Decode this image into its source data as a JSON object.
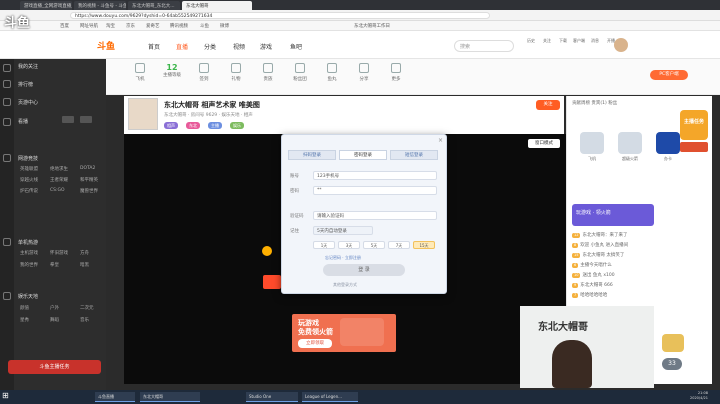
{
  "browser": {
    "tabs": [
      "游戏直播_全网游戏直播_斗鱼直播",
      "我的视频 - 斗鱼号 - 斗鱼",
      "东北大帽哥_东北大...",
      "东北大帽哥"
    ],
    "url": "https://www.douyu.com/9629?dyshid=0-64ab552549271634",
    "bookmarks": [
      "百度",
      "网址导航",
      "淘宝",
      "京东",
      "爱奇艺",
      "腾讯视频",
      "斗鱼",
      "微博",
      "东北大帽哥工作日"
    ]
  },
  "site": {
    "logo_text": "斗鱼",
    "nav": [
      "首页",
      "直播",
      "分类",
      "视频",
      "游戏",
      "鱼吧"
    ],
    "active_nav": "直播",
    "search_placeholder": "搜索",
    "header_icons": [
      "历史",
      "关注",
      "下载",
      "客户端",
      "消息",
      "开播"
    ]
  },
  "watermark": "斗鱼",
  "sidebar": {
    "sections": [
      {
        "title": "我的关注",
        "items": []
      },
      {
        "title": "排行榜",
        "items": []
      },
      {
        "title": "页游中心",
        "items": []
      },
      {
        "title": "看播",
        "items": []
      },
      {
        "title": "网游竞技",
        "items": [
          "英雄联盟",
          "绝地求生",
          "DOTA2",
          "穿越火线",
          "王者荣耀",
          "和平精英",
          "炉石传说",
          "CS:GO",
          "魔兽世界"
        ]
      },
      {
        "title": "单机热游",
        "items": [
          "主机游戏",
          "怀旧游戏",
          "方舟",
          "我的世界",
          "拳皇",
          "暗黑"
        ]
      },
      {
        "title": "娱乐天地",
        "items": [
          "颜值",
          "户外",
          "二次元",
          "星秀",
          "舞蹈",
          "音乐"
        ]
      }
    ],
    "promo": "斗鱼主播任务"
  },
  "category_bar": [
    {
      "icon": "plane-icon",
      "label": "飞机"
    },
    {
      "icon": "level-icon",
      "label": "主播等级",
      "value": "12"
    },
    {
      "icon": "edit-icon",
      "label": "签到"
    },
    {
      "icon": "gift-box-icon",
      "label": "礼物"
    },
    {
      "icon": "people-icon",
      "label": "贵族"
    },
    {
      "icon": "lock-icon",
      "label": "粉丝团"
    },
    {
      "icon": "game-icon",
      "label": "鱼丸"
    },
    {
      "icon": "shield-icon",
      "label": "分享"
    },
    {
      "icon": "mask-icon",
      "label": "更多"
    }
  ],
  "fans_button": "PC客户端",
  "room": {
    "title": "东北大帽哥 相声艺术家 唯美图",
    "meta": "东北大帽哥 · 房间号 9629 · 娱乐天地 · 相声",
    "tags": [
      "相声",
      "东北",
      "主播",
      "娱乐"
    ],
    "follow": "关注",
    "window_mode": "窗口模式"
  },
  "dialog": {
    "tabs": [
      "扫码登录",
      "密码登录",
      "短信登录"
    ],
    "active_tab": 1,
    "rows": [
      {
        "label": "账号",
        "value": "123手机号"
      },
      {
        "label": "密码",
        "value": "**"
      },
      {
        "label": "验证码",
        "value": "请输入验证码"
      },
      {
        "label": "记住",
        "value": "5天内自动登录"
      }
    ],
    "chips": [
      "1天",
      "3天",
      "5天",
      "7天",
      "15天"
    ],
    "selected_chip": 4,
    "link": "忘记密码 · 立即注册",
    "submit": "登 录",
    "footer": "其他登录方式",
    "close": "×"
  },
  "ad": {
    "line1": "玩游戏",
    "line2": "免费领火箭",
    "button": "立即领取"
  },
  "right": {
    "rank_header": "贡献周榜  贵宾(1)  粉丝",
    "gifts": [
      {
        "label": "飞机"
      },
      {
        "label": "超级火箭"
      },
      {
        "label": "办卡"
      }
    ],
    "task_badge": "主播任务",
    "chat_banner": "玩游戏 · 领火箭",
    "chat_lines": [
      "东北大帽哥：来了来了",
      "欢迎 小鱼丸 进入直播间",
      "东北大帽哥 太搞笑了",
      "主播今天唱什么",
      "送出 鱼丸 x100",
      "东北大帽哥 666",
      "哈哈哈哈哈哈",
      "欢迎 老粉 回家",
      "一起来看相声吧"
    ],
    "webcam_sign": "东北大帽哥",
    "num_badge": "33"
  },
  "taskbar": {
    "items": [
      "斗鱼直播",
      "东北大帽哥",
      "Studio One",
      "League of Legen..."
    ],
    "time": "21:08",
    "date": "2020/4/21"
  }
}
